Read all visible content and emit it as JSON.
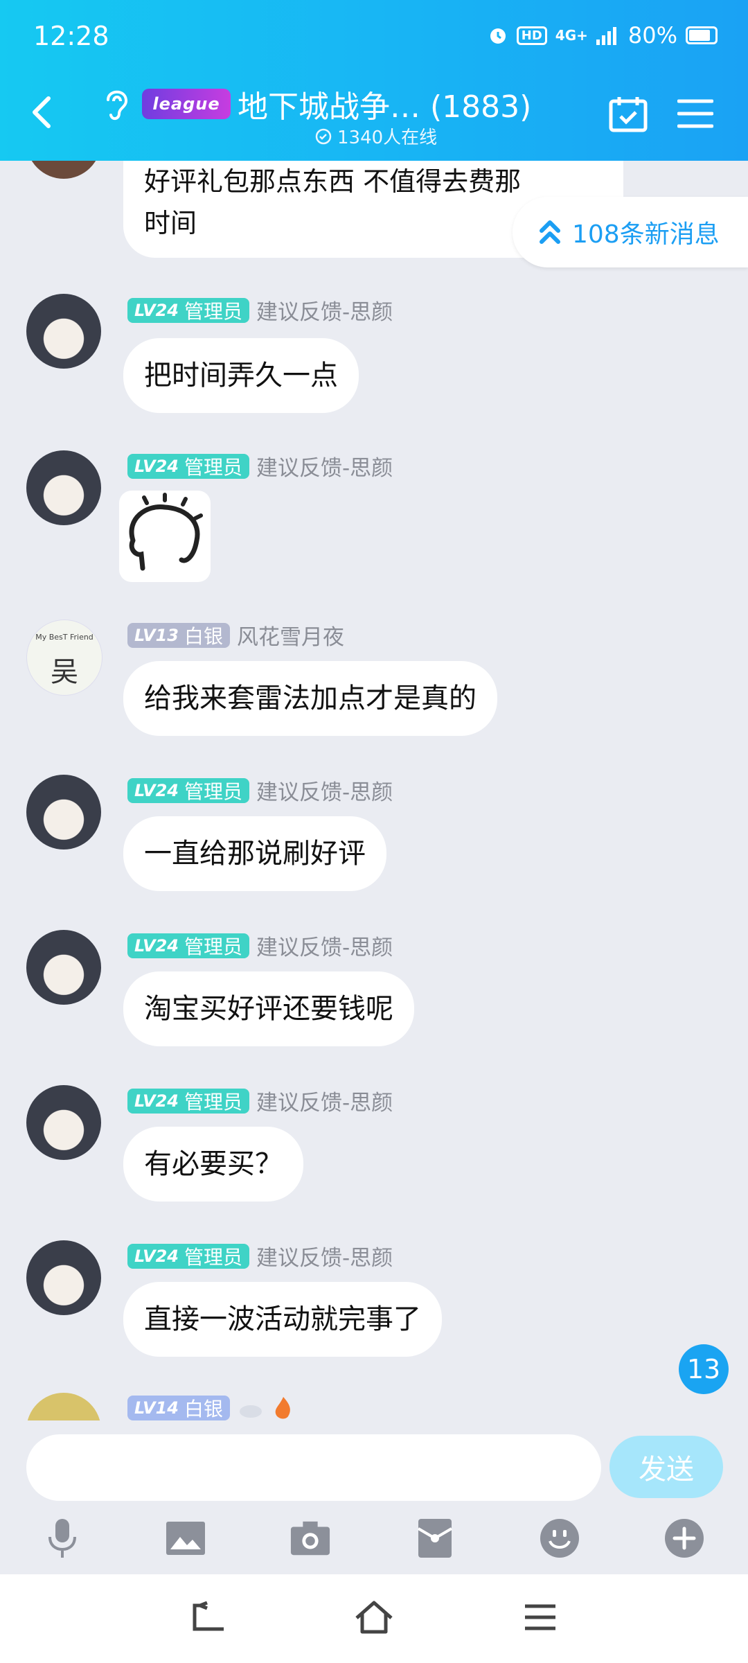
{
  "status_bar": {
    "time": "12:28",
    "network": "4G+",
    "hd": "HD",
    "battery": "80%"
  },
  "header": {
    "logo_text": "league",
    "title": "地下城战争… (1883)",
    "online": "1340人在线"
  },
  "new_messages": {
    "label": "108条新消息"
  },
  "messages": [
    {
      "text_lines": [
        "好评礼包那点东西 不值得去费那",
        "时间"
      ]
    },
    {
      "level": "LV24",
      "badge": "管理员",
      "nick": "建议反馈-思颜",
      "text": "把时间弄久一点"
    },
    {
      "level": "LV24",
      "badge": "管理员",
      "nick": "建议反馈-思颜"
    },
    {
      "level": "LV13",
      "badge": "白银",
      "nick": "风花雪月夜",
      "avatar_text_top": "My BesT Friend",
      "avatar_text": "吴",
      "text": "给我来套雷法加点才是真的"
    },
    {
      "level": "LV24",
      "badge": "管理员",
      "nick": "建议反馈-思颜",
      "text": "一直给那说刷好评"
    },
    {
      "level": "LV24",
      "badge": "管理员",
      "nick": "建议反馈-思颜",
      "text": "淘宝买好评还要钱呢"
    },
    {
      "level": "LV24",
      "badge": "管理员",
      "nick": "建议反馈-思颜",
      "text": "有必要买？"
    },
    {
      "level": "LV24",
      "badge": "管理员",
      "nick": "建议反馈-思颜",
      "text": "直接一波活动就完事了"
    },
    {
      "level": "LV14",
      "badge": "白银"
    }
  ],
  "unread_count": "13",
  "composer": {
    "send_label": "发送"
  },
  "toolbar_icons": [
    "microphone-icon",
    "image-icon",
    "camera-icon",
    "red-packet-icon",
    "emoji-icon",
    "plus-icon"
  ],
  "colors": {
    "header": "#18b4f4",
    "admin_badge": "#3fd3c6",
    "silver_badge": "#b3b8cf",
    "send_button": "#a6e6fb",
    "accent": "#1b9ef3"
  }
}
